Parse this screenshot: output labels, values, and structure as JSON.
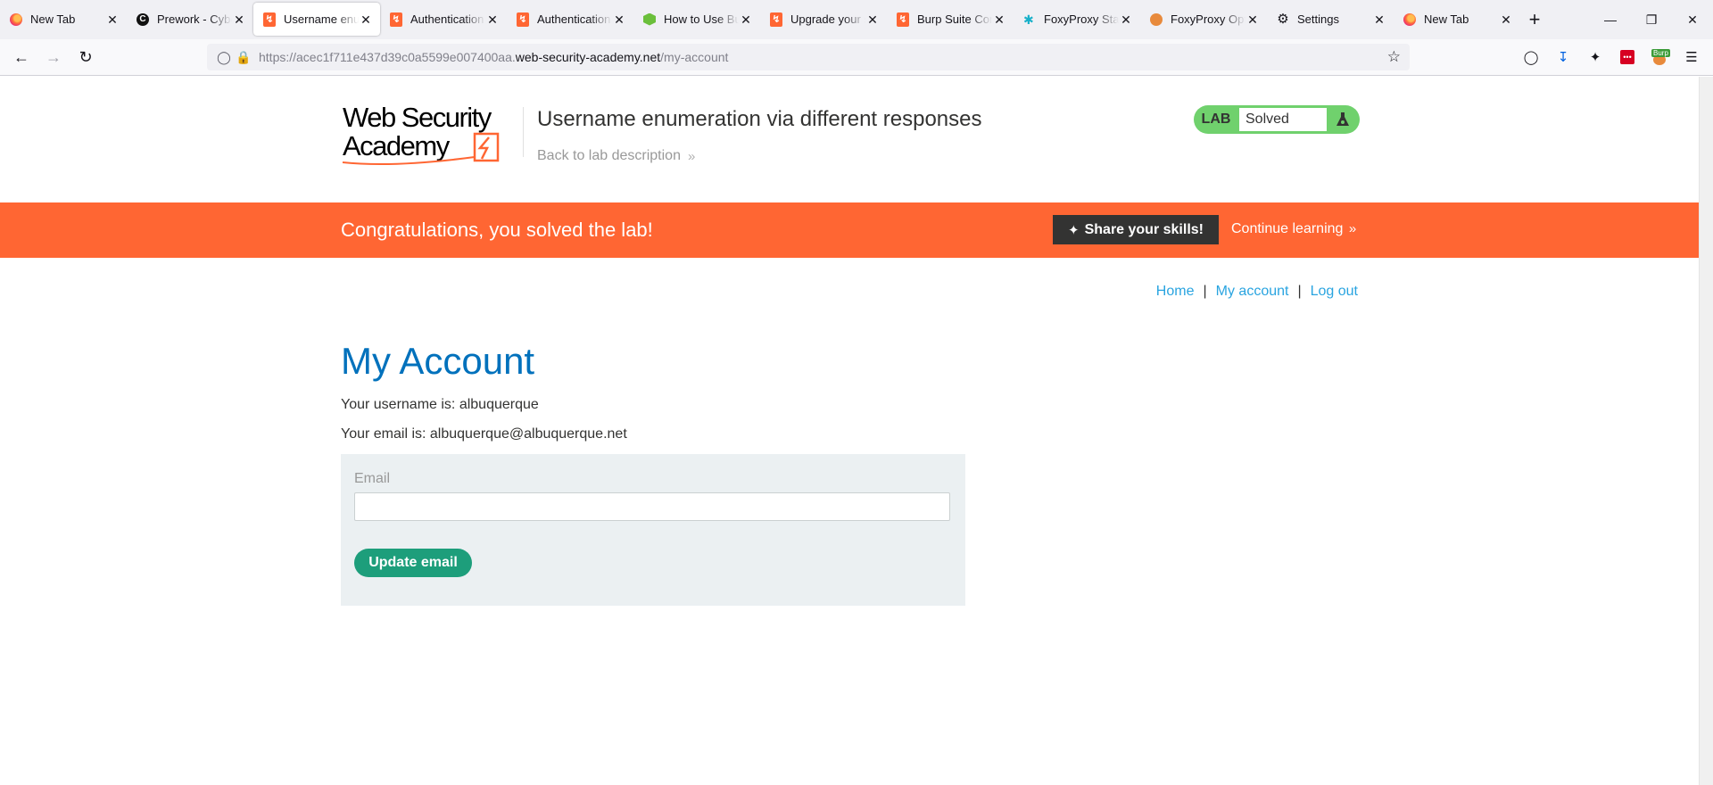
{
  "browser": {
    "tabs": [
      {
        "title": "New Tab",
        "favicon": "firefox-icon",
        "active": false
      },
      {
        "title": "Prework - CyberSec",
        "favicon": "c-icon",
        "active": false
      },
      {
        "title": "Username enumeration",
        "favicon": "burp-bolt-icon",
        "active": true
      },
      {
        "title": "Authentication lab",
        "favicon": "burp-bolt-icon",
        "active": false
      },
      {
        "title": "Authentication lab",
        "favicon": "burp-bolt-icon",
        "active": false
      },
      {
        "title": "How to Use Burp",
        "favicon": "hex-icon",
        "active": false
      },
      {
        "title": "Upgrade your skills",
        "favicon": "burp-bolt-icon",
        "active": false
      },
      {
        "title": "Burp Suite Community",
        "favicon": "burp-bolt-icon",
        "active": false
      },
      {
        "title": "FoxyProxy Standard",
        "favicon": "foxyproxy-icon",
        "active": false
      },
      {
        "title": "FoxyProxy Options",
        "favicon": "foxyproxy-options-icon",
        "active": false
      },
      {
        "title": "Settings",
        "favicon": "gear-icon",
        "active": false
      },
      {
        "title": "New Tab",
        "favicon": "firefox-icon",
        "active": false
      }
    ],
    "new_tab_label": "+",
    "url_prefix": "https://acec1f711e437d39c0a5599e007400aa.",
    "url_host": "web-security-academy.net",
    "url_path": "/my-account"
  },
  "header": {
    "logo_text_line1": "Web Security",
    "logo_text_line2": "Academy",
    "lab_title": "Username enumeration via different responses",
    "back_link": "Back to lab description",
    "lab_badge": "LAB",
    "lab_status": "Solved"
  },
  "banner": {
    "message": "Congratulations, you solved the lab!",
    "share_label": "Share your skills!",
    "continue_label": "Continue learning"
  },
  "nav": {
    "home": "Home",
    "my_account": "My account",
    "log_out": "Log out",
    "separator": "|"
  },
  "account": {
    "title": "My Account",
    "username_line": "Your username is: albuquerque",
    "email_line": "Your email is: albuquerque@albuquerque.net",
    "email_label": "Email",
    "email_value": "",
    "update_label": "Update email"
  },
  "colors": {
    "banner": "#ff6633",
    "title_blue": "#0071bc",
    "link_blue": "#29a4e0",
    "solved_green": "#70d16d",
    "button_green": "#1d9e7b"
  }
}
